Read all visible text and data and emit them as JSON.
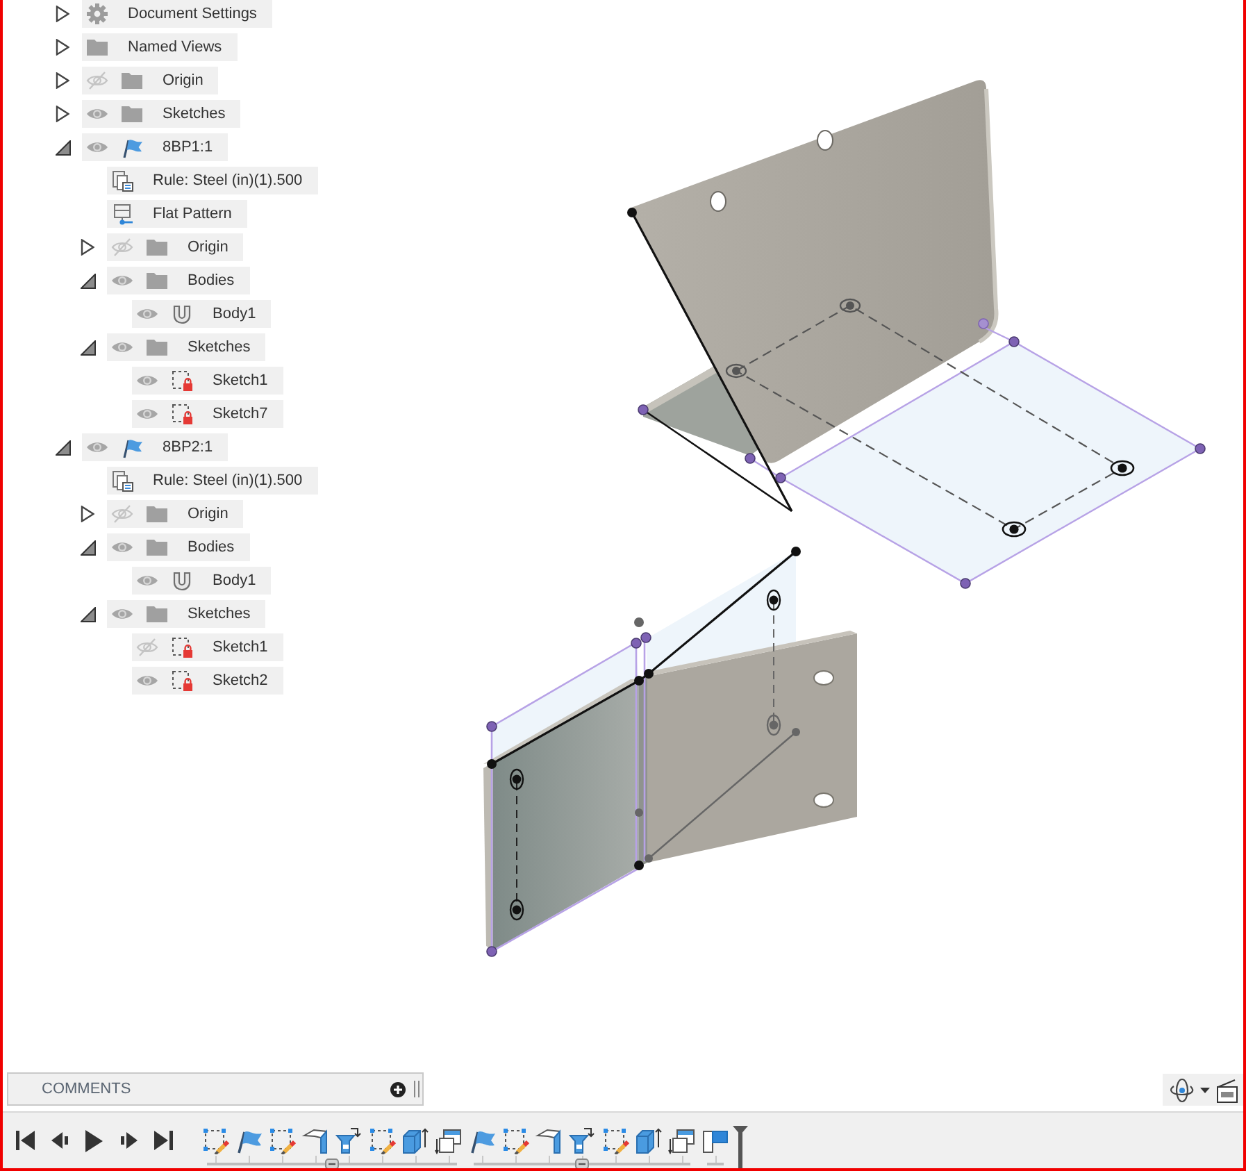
{
  "browser": {
    "items": [
      {
        "label": "Document Settings",
        "kind": "settings",
        "expanded": false
      },
      {
        "label": "Named Views",
        "kind": "folder",
        "expanded": false
      },
      {
        "label": "Origin",
        "kind": "folder",
        "visible": false,
        "expanded": false
      },
      {
        "label": "Sketches",
        "kind": "folder",
        "visible": true,
        "expanded": false
      },
      {
        "label": "8BP1:1",
        "kind": "component",
        "visible": true,
        "expanded": true,
        "children": [
          {
            "label": "Rule: Steel (in)(1).500",
            "kind": "rule"
          },
          {
            "label": "Flat Pattern",
            "kind": "flat-pattern"
          },
          {
            "label": "Origin",
            "kind": "folder",
            "visible": false,
            "expanded": false
          },
          {
            "label": "Bodies",
            "kind": "folder",
            "visible": true,
            "expanded": true,
            "children": [
              {
                "label": "Body1",
                "kind": "body",
                "visible": true
              }
            ]
          },
          {
            "label": "Sketches",
            "kind": "folder",
            "visible": true,
            "expanded": true,
            "children": [
              {
                "label": "Sketch1",
                "kind": "sketch",
                "visible": true
              },
              {
                "label": "Sketch7",
                "kind": "sketch",
                "visible": true
              }
            ]
          }
        ]
      },
      {
        "label": "8BP2:1",
        "kind": "component",
        "visible": true,
        "expanded": true,
        "children": [
          {
            "label": "Rule: Steel (in)(1).500",
            "kind": "rule"
          },
          {
            "label": "Origin",
            "kind": "folder",
            "visible": false,
            "expanded": false
          },
          {
            "label": "Bodies",
            "kind": "folder",
            "visible": true,
            "expanded": true,
            "children": [
              {
                "label": "Body1",
                "kind": "body",
                "visible": true
              }
            ]
          },
          {
            "label": "Sketches",
            "kind": "folder",
            "visible": true,
            "expanded": true,
            "children": [
              {
                "label": "Sketch1",
                "kind": "sketch",
                "visible": false
              },
              {
                "label": "Sketch2",
                "kind": "sketch",
                "visible": true
              }
            ]
          }
        ]
      }
    ]
  },
  "comments": {
    "title": "COMMENTS"
  },
  "timeline": {
    "groups": [
      {
        "features": [
          {
            "kind": "sketch"
          },
          {
            "kind": "component"
          },
          {
            "kind": "sketch"
          },
          {
            "kind": "flange"
          },
          {
            "kind": "unfold"
          },
          {
            "kind": "sketch"
          },
          {
            "kind": "extrude"
          },
          {
            "kind": "convert"
          }
        ]
      },
      {
        "features": [
          {
            "kind": "component"
          },
          {
            "kind": "sketch"
          },
          {
            "kind": "flange"
          },
          {
            "kind": "unfold"
          },
          {
            "kind": "sketch"
          },
          {
            "kind": "extrude"
          },
          {
            "kind": "convert"
          }
        ]
      },
      {
        "features": [
          {
            "kind": "flat-pattern"
          }
        ]
      }
    ]
  }
}
